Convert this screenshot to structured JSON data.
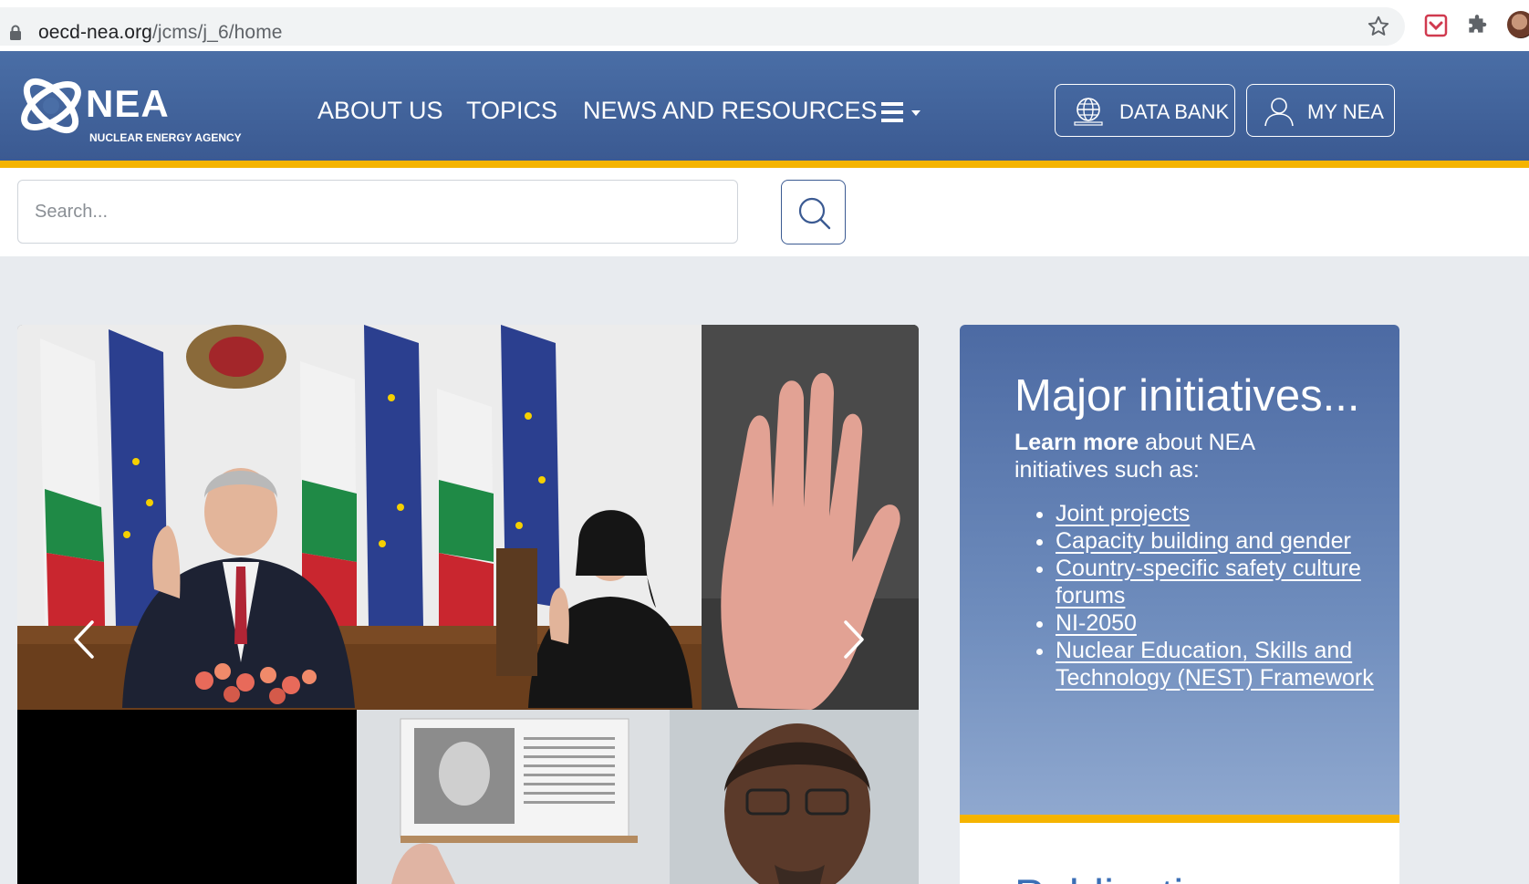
{
  "browser": {
    "url_host": "oecd-nea.org",
    "url_path": "/jcms/j_6/home"
  },
  "header": {
    "logo_title": "NEA",
    "logo_subtitle": "NUCLEAR ENERGY AGENCY",
    "nav": [
      "ABOUT US",
      "TOPICS",
      "NEWS AND RESOURCES"
    ],
    "data_bank_label": "DATA BANK",
    "my_nea_label": "MY NEA",
    "accent_color": "#f5b400",
    "brand_color": "#3b5a92"
  },
  "search": {
    "placeholder": "Search..."
  },
  "panel": {
    "title": "Major initiatives...",
    "intro_bold": "Learn more",
    "intro_rest": " about NEA initiatives such as:",
    "items": [
      "Joint projects",
      "Capacity building and gender",
      "Country-specific safety culture forums",
      "NI-2050",
      "Nuclear Education, Skills and Technology (NEST) Framework"
    ]
  },
  "publications": {
    "heading": "Publications"
  },
  "icons": {
    "lock": "lock-icon",
    "star": "star-icon",
    "menu": "hamburger-icon",
    "globe": "globe-icon",
    "user": "user-icon",
    "search": "search-icon",
    "prev": "chevron-left-icon",
    "next": "chevron-right-icon"
  }
}
